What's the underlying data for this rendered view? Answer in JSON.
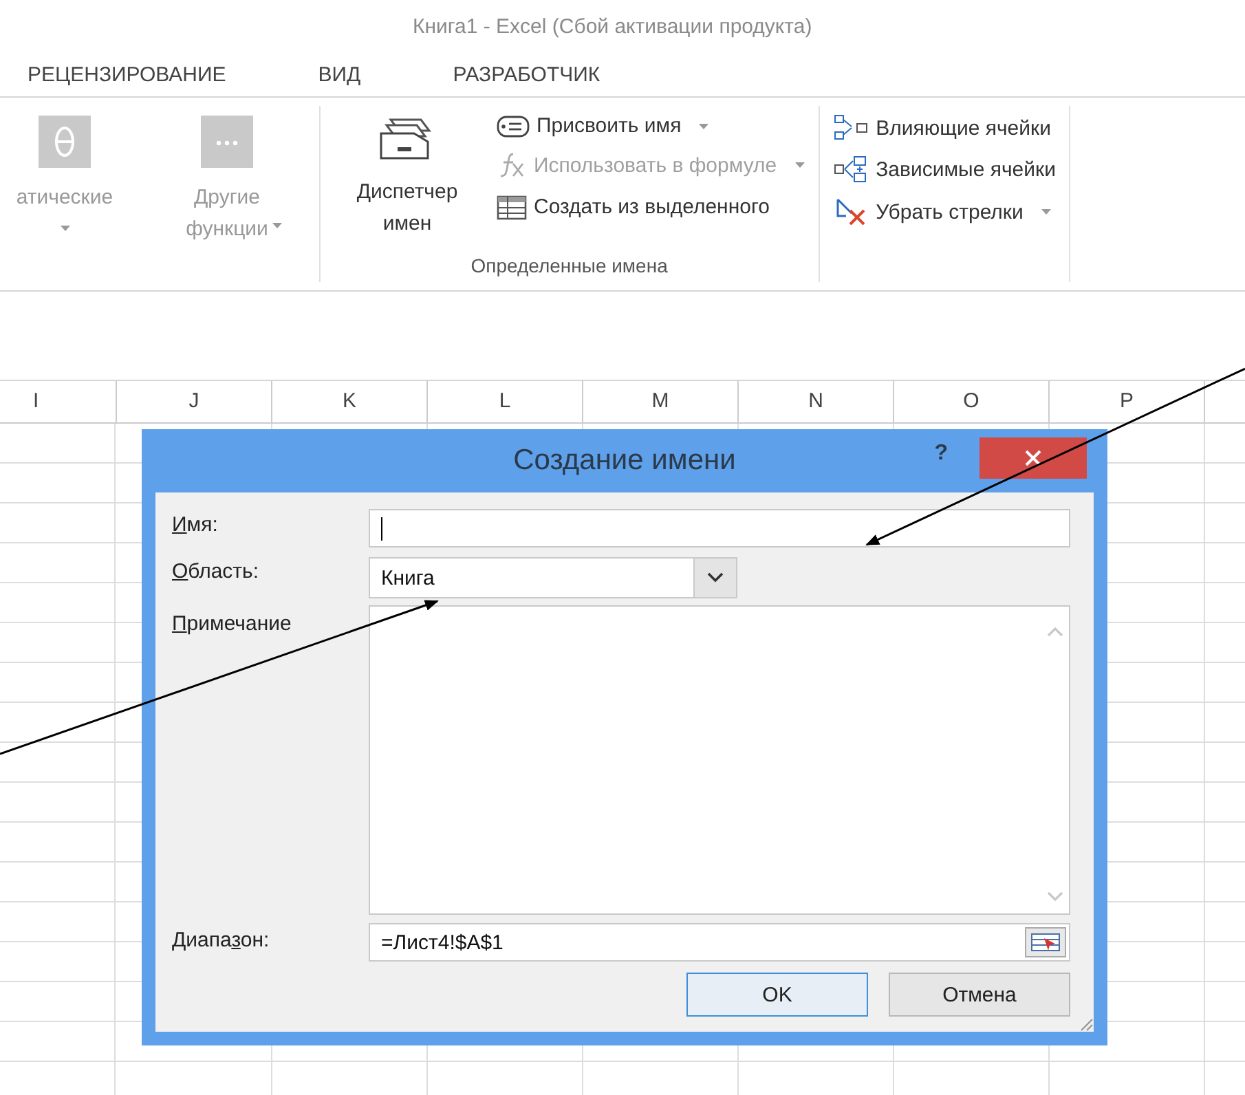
{
  "window": {
    "title": "Книга1 - Excel (Сбой активации продукта)"
  },
  "ribbon_tabs": [
    "РЕЦЕНЗИРОВАНИЕ",
    "ВИД",
    "РАЗРАБОТЧИК"
  ],
  "ribbon_groups": [
    {
      "large_buttons": [
        {
          "label": "атические",
          "disabled": true,
          "dropdown": true
        },
        {
          "label": "Другие функции",
          "disabled": true,
          "dropdown": true
        }
      ]
    },
    {
      "label": "Определенные имена",
      "large_buttons": [
        {
          "label": "Диспетчер имен",
          "disabled": false,
          "dropdown": false
        }
      ],
      "small_buttons": [
        {
          "label": "Присвоить имя",
          "disabled": false,
          "dropdown": true
        },
        {
          "label": "Использовать в формуле",
          "disabled": true,
          "dropdown": true
        },
        {
          "label": "Создать из выделенного",
          "disabled": false,
          "dropdown": false
        }
      ]
    },
    {
      "small_buttons": [
        {
          "label": "Влияющие ячейки",
          "disabled": false,
          "dropdown": false
        },
        {
          "label": "Зависимые ячейки",
          "disabled": false,
          "dropdown": false
        },
        {
          "label": "Убрать стрелки",
          "disabled": false,
          "dropdown": true
        }
      ]
    }
  ],
  "columns": [
    "I",
    "J",
    "K",
    "L",
    "M",
    "N",
    "O",
    "P"
  ],
  "dialog": {
    "title": "Создание имени",
    "help": "?",
    "name_field": {
      "label": {
        "key": "И",
        "post": "мя:"
      }
    },
    "scope_field": {
      "label": {
        "key": "О",
        "post": "бласть:"
      },
      "value": "Книга"
    },
    "comment_field": {
      "label": {
        "key": "П",
        "post": "римечание"
      }
    },
    "range_field": {
      "label": {
        "pre": "Диапа",
        "key": "з",
        "post": "он:"
      },
      "value": "=Лист4!$A$1"
    },
    "buttons": [
      {
        "label": "OK",
        "default": true
      },
      {
        "label": "Отмена",
        "default": false
      }
    ]
  }
}
